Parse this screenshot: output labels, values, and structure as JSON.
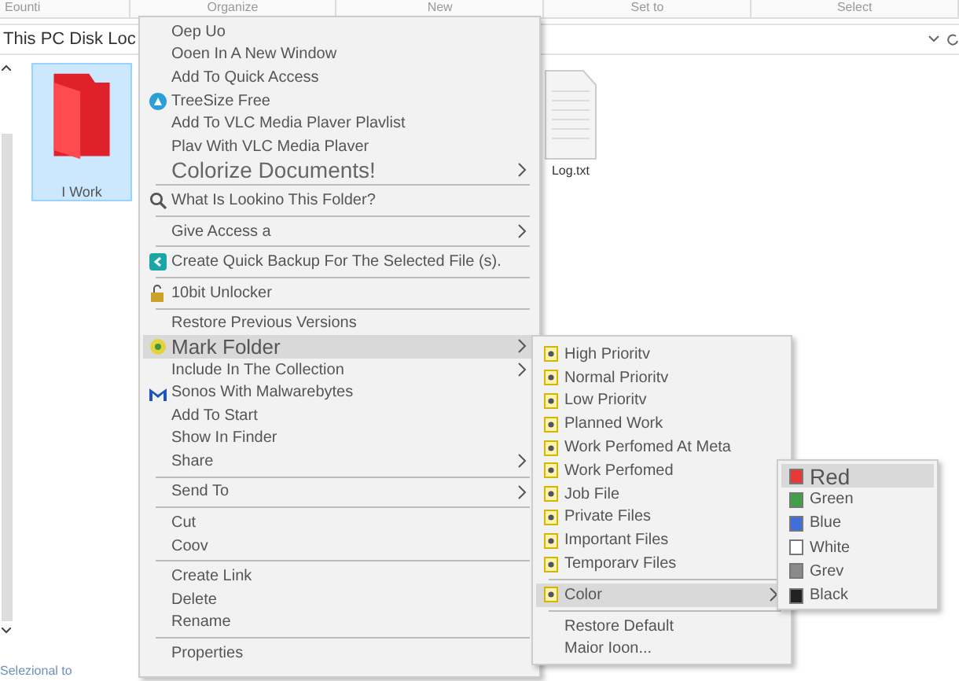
{
  "ribbon": [
    "Eounti",
    "Organize",
    "New",
    "Set to",
    "Select"
  ],
  "address": "This PC Disk Loc",
  "files": [
    {
      "kind": "folder",
      "name": "I Work",
      "selected": true
    },
    {
      "kind": "document",
      "name": "Log.txt",
      "selected": false
    }
  ],
  "status_bar": "Selezional to",
  "context_menu": [
    {
      "kind": "plain",
      "label": "Oep Uo",
      "submenu": false,
      "highlighted": false
    },
    {
      "kind": "plain",
      "label": "Ooen In A New Window",
      "submenu": false,
      "highlighted": false
    },
    {
      "kind": "plain",
      "label": "Add To Quick Access",
      "submenu": false,
      "highlighted": false
    },
    {
      "kind": "treesize",
      "label": "TreeSize Free",
      "submenu": false,
      "highlighted": false
    },
    {
      "kind": "plain",
      "label": "Add To VLC Media Plaver Plavlist",
      "submenu": false,
      "highlighted": false
    },
    {
      "kind": "plain",
      "label": "Plav With VLC Media Plaver",
      "submenu": false,
      "highlighted": false
    },
    {
      "kind": "plain",
      "label": "Colorize Documents!",
      "submenu": true,
      "highlighted": false
    },
    {
      "kind": "separator"
    },
    {
      "kind": "magnifier",
      "label": "What Is Lookino This Folder?",
      "submenu": false,
      "highlighted": false
    },
    {
      "kind": "separator"
    },
    {
      "kind": "plain",
      "label": "Give Access a",
      "submenu": true,
      "highlighted": false
    },
    {
      "kind": "separator"
    },
    {
      "kind": "backup",
      "label": "Create Quick Backup For The Selected File (s).",
      "submenu": false,
      "highlighted": false
    },
    {
      "kind": "separator"
    },
    {
      "kind": "unlock",
      "label": "10bit Unlocker",
      "submenu": false,
      "highlighted": false
    },
    {
      "kind": "separator"
    },
    {
      "kind": "plain",
      "label": "Restore Previous Versions",
      "submenu": false,
      "highlighted": false
    },
    {
      "kind": "tag",
      "label": "Mark Folder",
      "submenu": true,
      "highlighted": true
    },
    {
      "kind": "plain",
      "label": "Include In The Collection",
      "submenu": true,
      "highlighted": false
    },
    {
      "kind": "shield",
      "label": "Sonos With Malwarebytes",
      "submenu": false,
      "highlighted": false
    },
    {
      "kind": "plain",
      "label": "Add To Start",
      "submenu": false,
      "highlighted": false
    },
    {
      "kind": "plain",
      "label": "Show In Finder",
      "submenu": false,
      "highlighted": false
    },
    {
      "kind": "plain",
      "label": "Share",
      "submenu": true,
      "highlighted": false
    },
    {
      "kind": "separator"
    },
    {
      "kind": "plain",
      "label": "Send To",
      "submenu": true,
      "highlighted": false
    },
    {
      "kind": "separator"
    },
    {
      "kind": "plain",
      "label": "Cut",
      "submenu": false,
      "highlighted": false
    },
    {
      "kind": "plain",
      "label": "Coov",
      "submenu": false,
      "highlighted": false
    },
    {
      "kind": "separator"
    },
    {
      "kind": "plain",
      "label": "Create Link",
      "submenu": false,
      "highlighted": false
    },
    {
      "kind": "plain",
      "label": "Delete",
      "submenu": false,
      "highlighted": false
    },
    {
      "kind": "plain",
      "label": "Rename",
      "submenu": false,
      "highlighted": false
    },
    {
      "kind": "separator"
    },
    {
      "kind": "plain",
      "label": "Properties",
      "submenu": false,
      "highlighted": false
    }
  ],
  "mark_folder_menu": [
    {
      "kind": "tag",
      "label": "High Prioritv",
      "submenu": false,
      "highlighted": false
    },
    {
      "kind": "tag",
      "label": "Normal Prioritv",
      "submenu": false,
      "highlighted": false
    },
    {
      "kind": "tag",
      "label": "Low Prioritv",
      "submenu": false,
      "highlighted": false
    },
    {
      "kind": "tag",
      "label": "Planned Work",
      "submenu": false,
      "highlighted": false
    },
    {
      "kind": "tag",
      "label": "Work Perfomed At Meta",
      "submenu": false,
      "highlighted": false
    },
    {
      "kind": "tag",
      "label": "Work Perfomed",
      "submenu": false,
      "highlighted": false
    },
    {
      "kind": "tag",
      "label": "Job File",
      "submenu": false,
      "highlighted": false
    },
    {
      "kind": "tag",
      "label": "Private Files",
      "submenu": false,
      "highlighted": false
    },
    {
      "kind": "tag",
      "label": "Important Files",
      "submenu": false,
      "highlighted": false
    },
    {
      "kind": "tag",
      "label": "Temporarv Files",
      "submenu": false,
      "highlighted": false
    },
    {
      "kind": "separator"
    },
    {
      "kind": "tag",
      "label": "Color",
      "submenu": true,
      "highlighted": true
    },
    {
      "kind": "separator"
    },
    {
      "kind": "plain",
      "label": "Restore Default",
      "submenu": false,
      "highlighted": false
    },
    {
      "kind": "plain",
      "label": "Maior Ioon...",
      "submenu": false,
      "highlighted": false
    }
  ],
  "color_menu": [
    {
      "label": "Red",
      "color": "#e53935",
      "highlighted": true
    },
    {
      "label": "Green",
      "color": "#43a047",
      "highlighted": false
    },
    {
      "label": "Blue",
      "color": "#3f6fd8",
      "highlighted": false
    },
    {
      "label": "White",
      "color": "#ffffff",
      "highlighted": false
    },
    {
      "label": "Grev",
      "color": "#8a8a8a",
      "highlighted": false
    },
    {
      "label": "Black",
      "color": "#222222",
      "highlighted": false
    }
  ]
}
